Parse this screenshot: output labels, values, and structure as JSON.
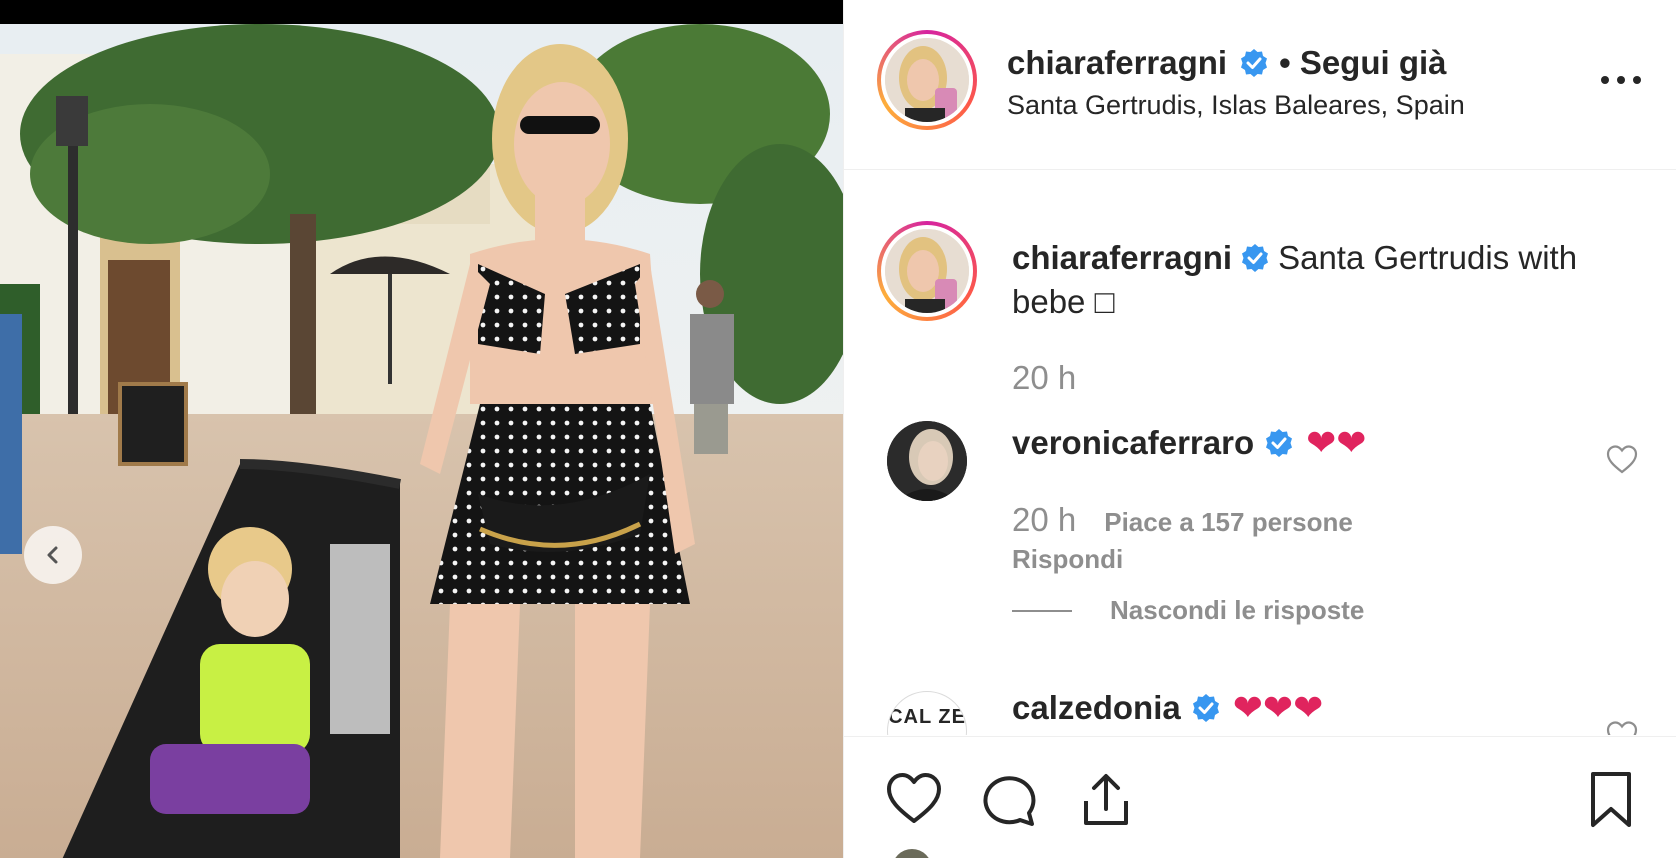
{
  "post": {
    "username": "chiaraferragni",
    "follow_status": "• Segui già",
    "location": "Santa Gertrudis, Islas Baleares, Spain",
    "more_icon": "more-horizontal-icon",
    "verified_icon": "verified-badge-icon"
  },
  "caption": {
    "username": "chiaraferragni",
    "text": "Santa Gertrudis with bebe □",
    "time": "20 h"
  },
  "replies": [
    {
      "username": "veronicaferraro",
      "text": "❤❤",
      "time": "20 h",
      "likes": "Piace a 157 persone",
      "reply_label": "Rispondi",
      "hide_label": "Nascondi le risposte"
    },
    {
      "username": "calzedonia",
      "text": "❤❤❤",
      "avatar_text": "CAL ZE"
    }
  ],
  "actions": {
    "like_icon": "heart-icon",
    "comment_icon": "comment-icon",
    "share_icon": "share-icon",
    "save_icon": "bookmark-icon"
  },
  "photo": {
    "nav_icon": "chevron-left-icon"
  },
  "colors": {
    "verified": "#3897f0",
    "muted": "#8e8e8e",
    "text": "#262626",
    "heart": "#e0245e"
  }
}
